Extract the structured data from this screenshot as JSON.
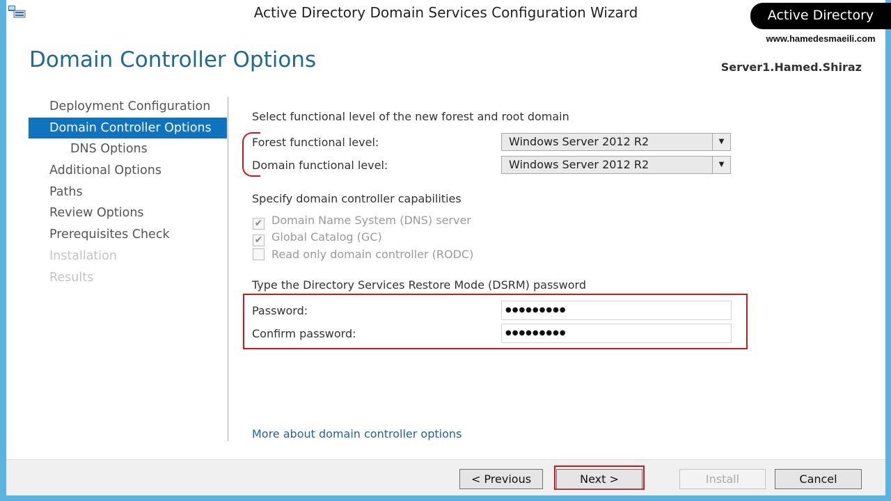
{
  "window": {
    "title": "Active Directory Domain Services Configuration Wizard"
  },
  "brand": {
    "top": "Active Directory",
    "url": "www.hamedesmaeili.com"
  },
  "page": {
    "title": "Domain Controller Options",
    "server": "Server1.Hamed.Shiraz"
  },
  "nav": {
    "items": [
      {
        "label": "Deployment Configuration",
        "state": "normal"
      },
      {
        "label": "Domain Controller Options",
        "state": "active"
      },
      {
        "label": "DNS Options",
        "state": "sub"
      },
      {
        "label": "Additional Options",
        "state": "normal"
      },
      {
        "label": "Paths",
        "state": "normal"
      },
      {
        "label": "Review Options",
        "state": "normal"
      },
      {
        "label": "Prerequisites Check",
        "state": "normal"
      },
      {
        "label": "Installation",
        "state": "disabled"
      },
      {
        "label": "Results",
        "state": "disabled"
      }
    ]
  },
  "functional": {
    "heading": "Select functional level of the new forest and root domain",
    "forest_label": "Forest functional level:",
    "forest_value": "Windows Server 2012 R2",
    "domain_label": "Domain functional level:",
    "domain_value": "Windows Server 2012 R2"
  },
  "capabilities": {
    "heading": "Specify domain controller capabilities",
    "dns": {
      "label": "Domain Name System (DNS) server",
      "checked": true
    },
    "gc": {
      "label": "Global Catalog (GC)",
      "checked": true
    },
    "rodc": {
      "label": "Read only domain controller (RODC)",
      "checked": false
    }
  },
  "dsrm": {
    "heading": "Type the Directory Services Restore Mode (DSRM) password",
    "password_label": "Password:",
    "password_value": "●●●●●●●●●",
    "confirm_label": "Confirm password:",
    "confirm_value": "●●●●●●●●●"
  },
  "link": "More about domain controller options",
  "buttons": {
    "previous": "< Previous",
    "next": "Next >",
    "install": "Install",
    "cancel": "Cancel"
  },
  "icons": {
    "app": "server-manager-icon",
    "dropdown": "chevron-down-icon",
    "check": "checkmark-icon"
  },
  "colors": {
    "accent": "#0e73c1",
    "title": "#1e6a95",
    "highlight": "#d4151c",
    "link": "#1f62a6"
  }
}
